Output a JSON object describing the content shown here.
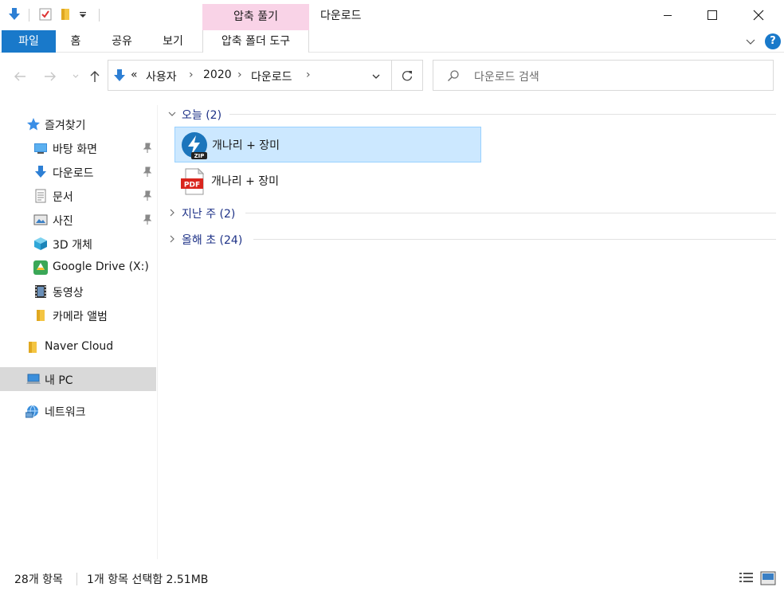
{
  "window": {
    "title": "다운로드",
    "context_header": "압축 풀기"
  },
  "ribbon": {
    "tabs": [
      "파일",
      "홈",
      "공유",
      "보기"
    ],
    "context_tab": "압축 폴더 도구",
    "help_label": "?"
  },
  "address": {
    "overflow": "«",
    "segments": [
      "사용자",
      "2020",
      "다운로드"
    ]
  },
  "search": {
    "placeholder": "다운로드 검색"
  },
  "sidebar": {
    "quick_access": "즐겨찾기",
    "items": [
      {
        "label": "바탕 화면",
        "icon": "desktop-icon",
        "pinned": true
      },
      {
        "label": "다운로드",
        "icon": "download-arrow-icon",
        "pinned": true
      },
      {
        "label": "문서",
        "icon": "document-icon",
        "pinned": true
      },
      {
        "label": "사진",
        "icon": "pictures-icon",
        "pinned": true
      },
      {
        "label": "3D 개체",
        "icon": "3d-objects-icon",
        "pinned": false
      },
      {
        "label": "Google Drive (X:)",
        "icon": "google-drive-icon",
        "pinned": false
      },
      {
        "label": "동영상",
        "icon": "video-icon",
        "pinned": false
      },
      {
        "label": "카메라 앨범",
        "icon": "folder-icon",
        "pinned": false
      }
    ],
    "naver_cloud": "Naver Cloud",
    "this_pc": "내 PC",
    "network": "네트워크"
  },
  "groups": [
    {
      "label": "오늘 (2)",
      "expanded": true
    },
    {
      "label": "지난 주 (2)",
      "expanded": false
    },
    {
      "label": "올해 초 (24)",
      "expanded": false
    }
  ],
  "files": [
    {
      "name": "개나리 + 장미",
      "type": "zip",
      "icon_badge": "ZIP",
      "selected": true
    },
    {
      "name": "개나리 + 장미",
      "type": "pdf",
      "icon_badge": "PDF",
      "selected": false
    }
  ],
  "status": {
    "count": "28개 항목",
    "selection": "1개 항목 선택함 2.51MB"
  },
  "colors": {
    "accent": "#1979ca",
    "context_tab": "#f9d3e7",
    "selection_bg": "#cce8ff",
    "group_text": "#1e3287"
  }
}
